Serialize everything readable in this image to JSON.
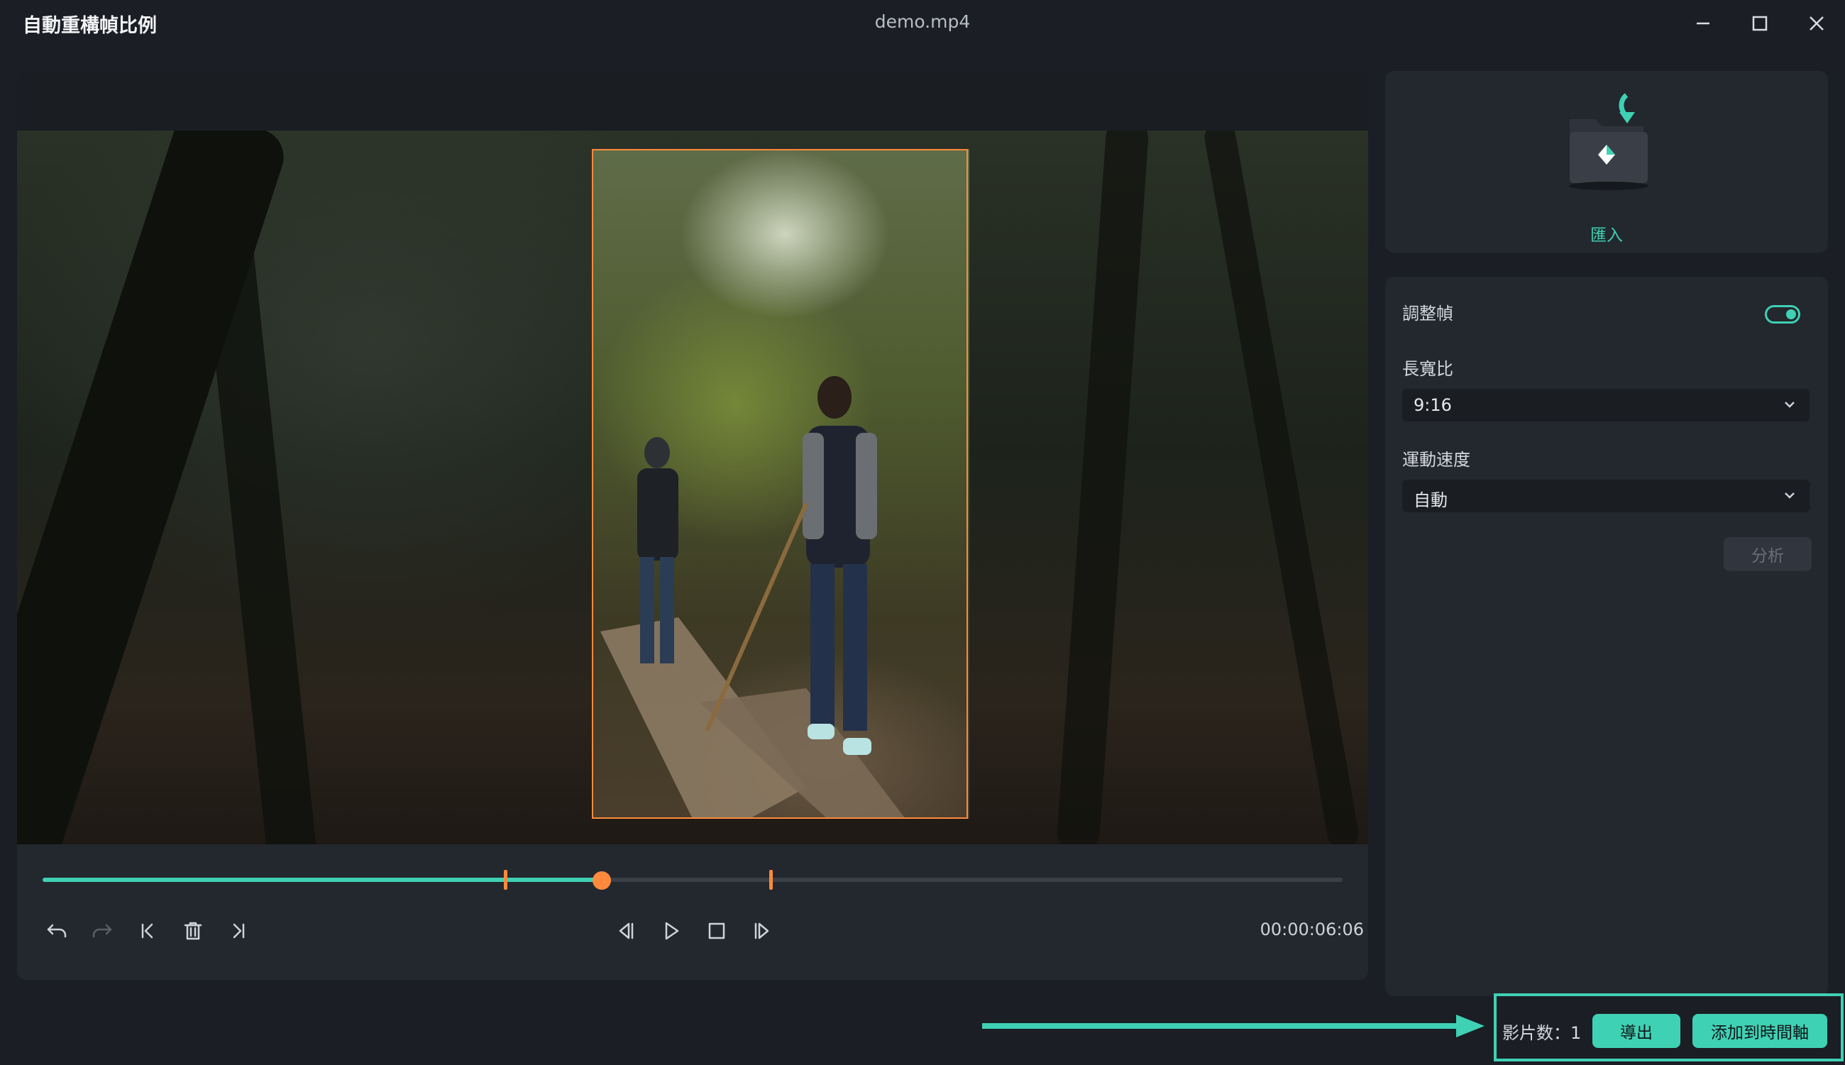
{
  "window": {
    "app_title": "自動重構幀比例",
    "file_name": "demo.mp4",
    "controls": [
      "minimize-icon",
      "maximize-icon",
      "close-icon"
    ]
  },
  "player": {
    "timecode": "00:00:06:06",
    "progress": 0.43,
    "markers": [
      0.356,
      0.56
    ],
    "controls": [
      "undo-icon",
      "redo-icon",
      "jump-to-start-icon",
      "delete-icon",
      "jump-to-end-icon",
      "previous-frame-icon",
      "play-icon",
      "stop-icon",
      "next-frame-icon"
    ]
  },
  "import": {
    "label": "匯入",
    "icon": "import-folder-icon"
  },
  "settings": {
    "adjust_frame_label": "調整幀",
    "adjust_frame_enabled": true,
    "aspect_ratio_label": "長寬比",
    "aspect_ratio_value": "9:16",
    "motion_speed_label": "運動速度",
    "motion_speed_value": "自動",
    "analyze_label": "分析"
  },
  "footer": {
    "clip_count_text": "影片数：1",
    "export_label": "導出",
    "add_to_timeline_label": "添加到時間軸"
  },
  "colors": {
    "accent": "#3fd1b3",
    "marker": "#ff8a3d",
    "background": "#1b1e24",
    "panel": "#23272e"
  }
}
